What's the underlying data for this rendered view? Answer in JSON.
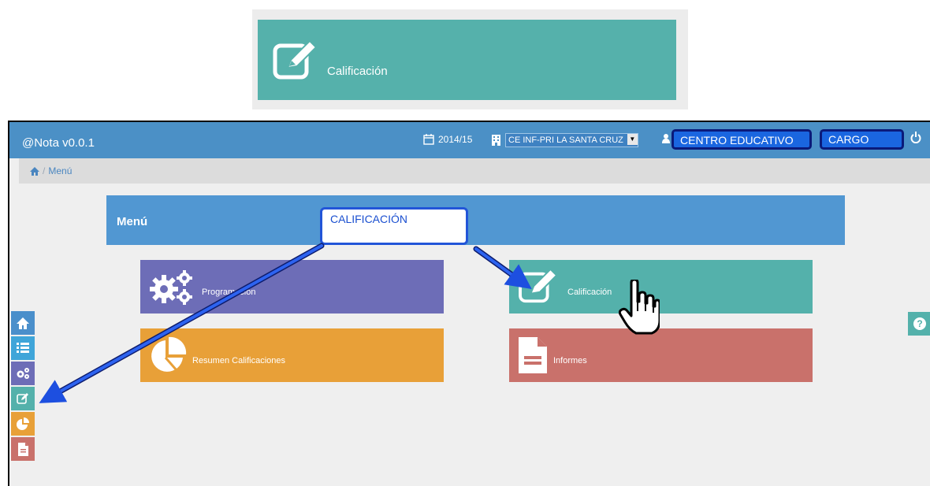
{
  "zoom": {
    "label": "Calificación",
    "icon": "edit-icon"
  },
  "header": {
    "brand": "@Nota v0.0.1",
    "year": "2014/15",
    "center": "CE INF-PRI LA SANTA CRUZ",
    "centro_label": "CENTRO EDUCATIVO",
    "cargo_label": "CARGO"
  },
  "breadcrumb": {
    "separator": "/",
    "item": "Menú"
  },
  "menu": {
    "title": "Menú",
    "callout": "CALIFICACIÓN",
    "tiles": [
      {
        "label": "Programación",
        "icon": "cogs-icon",
        "color": "#6d6db7"
      },
      {
        "label": "Calificación",
        "icon": "edit-icon",
        "color": "#54b1ab"
      },
      {
        "label": "Resumen Calificaciones",
        "icon": "pie-chart-icon",
        "color": "#e8a038"
      },
      {
        "label": "Informes",
        "icon": "document-icon",
        "color": "#c9716b"
      }
    ]
  },
  "sidebar": {
    "items": [
      {
        "icon": "home-icon",
        "color": "#4a8fcb"
      },
      {
        "icon": "list-icon",
        "color": "#3fa5d9"
      },
      {
        "icon": "cogs-icon",
        "color": "#6d6db7"
      },
      {
        "icon": "edit-icon",
        "color": "#54b1ab"
      },
      {
        "icon": "pie-chart-icon",
        "color": "#e8a038"
      },
      {
        "icon": "document-icon",
        "color": "#c9716b"
      }
    ]
  },
  "help": {
    "icon": "question-icon",
    "symbol": "?"
  }
}
